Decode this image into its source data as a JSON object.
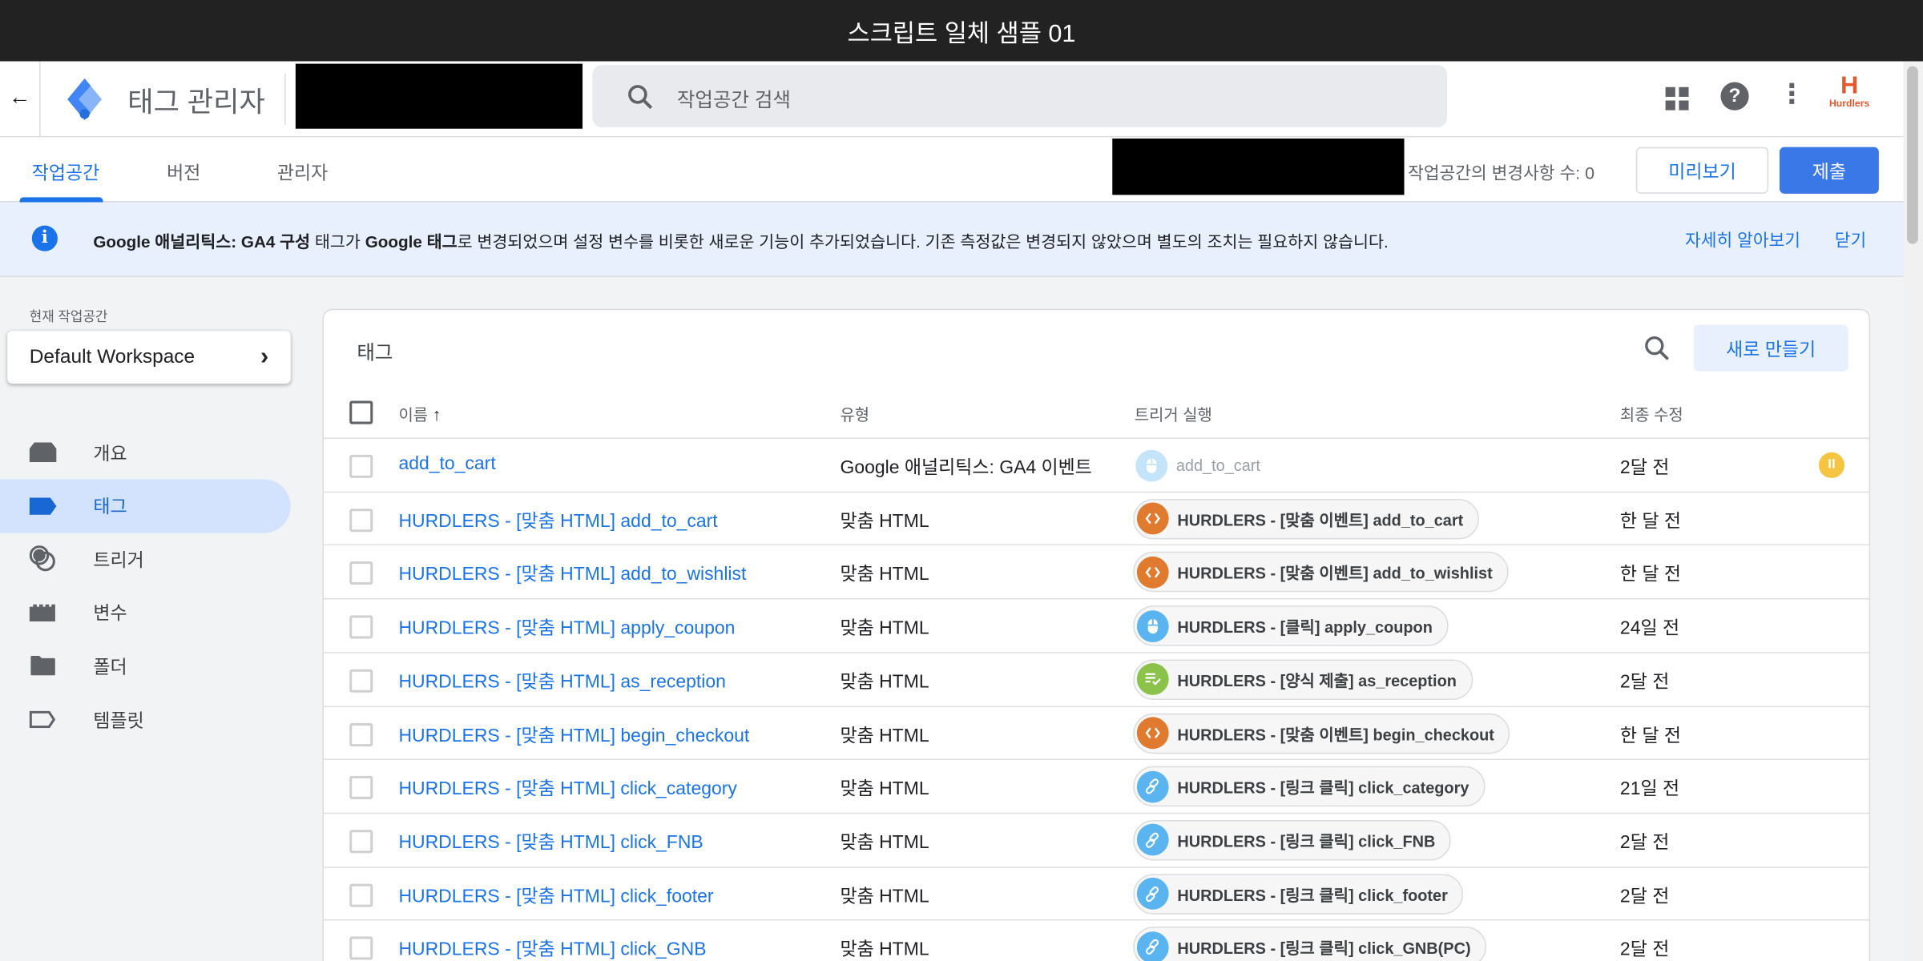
{
  "window_title": "스크립트 일체 샘플 01",
  "header": {
    "app_name": "태그 관리자",
    "search_placeholder": "작업공간 검색",
    "brand_logo_text": "Hurdlers"
  },
  "tabs": [
    {
      "label": "작업공간",
      "active": true
    },
    {
      "label": "버전",
      "active": false
    },
    {
      "label": "관리자",
      "active": false
    }
  ],
  "workspace_changes": "작업공간의 변경사항 수: 0",
  "preview_label": "미리보기",
  "submit_label": "제출",
  "banner": {
    "bold1": "Google 애널리틱스: GA4 구성",
    "text1": " 태그가 ",
    "bold2": "Google 태그",
    "text2": "로 변경되었으며 설정 변수를 비롯한 새로운 기능이 추가되었습니다. 기존 측정값은 변경되지 않았으며 별도의 조치는 필요하지 않습니다.",
    "learn_more": "자세히 알아보기",
    "close": "닫기"
  },
  "sidebar": {
    "workspace_label": "현재 작업공간",
    "workspace_name": "Default Workspace",
    "items": [
      {
        "label": "개요",
        "icon": "overview-icon"
      },
      {
        "label": "태그",
        "icon": "tag-icon",
        "active": true
      },
      {
        "label": "트리거",
        "icon": "trigger-icon"
      },
      {
        "label": "변수",
        "icon": "variable-icon"
      },
      {
        "label": "폴더",
        "icon": "folder-icon"
      },
      {
        "label": "템플릿",
        "icon": "template-icon"
      }
    ]
  },
  "tags_panel": {
    "title": "태그",
    "new_button": "새로 만들기",
    "columns": [
      "이름",
      "유형",
      "트리거 실행",
      "최종 수정"
    ],
    "rows": [
      {
        "name": "add_to_cart",
        "type": "Google 애널리틱스: GA4 이벤트",
        "trigger": "add_to_cart",
        "trigger_kind": "click",
        "paused": true,
        "modified": "2달 전"
      },
      {
        "name": "HURDLERS - [맞춤 HTML] add_to_cart",
        "type": "맞춤 HTML",
        "trigger": "HURDLERS - [맞춤 이벤트] add_to_cart",
        "trigger_kind": "custom",
        "modified": "한 달 전"
      },
      {
        "name": "HURDLERS - [맞춤 HTML] add_to_wishlist",
        "type": "맞춤 HTML",
        "trigger": "HURDLERS - [맞춤 이벤트] add_to_wishlist",
        "trigger_kind": "custom",
        "modified": "한 달 전"
      },
      {
        "name": "HURDLERS - [맞춤 HTML] apply_coupon",
        "type": "맞춤 HTML",
        "trigger": "HURDLERS - [클릭] apply_coupon",
        "trigger_kind": "click",
        "modified": "24일 전"
      },
      {
        "name": "HURDLERS - [맞춤 HTML] as_reception",
        "type": "맞춤 HTML",
        "trigger": "HURDLERS - [양식 제출] as_reception",
        "trigger_kind": "form",
        "modified": "2달 전"
      },
      {
        "name": "HURDLERS - [맞춤 HTML] begin_checkout",
        "type": "맞춤 HTML",
        "trigger": "HURDLERS - [맞춤 이벤트] begin_checkout",
        "trigger_kind": "custom",
        "modified": "한 달 전"
      },
      {
        "name": "HURDLERS - [맞춤 HTML] click_category",
        "type": "맞춤 HTML",
        "trigger": "HURDLERS - [링크 클릭] click_category",
        "trigger_kind": "link",
        "modified": "21일 전"
      },
      {
        "name": "HURDLERS - [맞춤 HTML] click_FNB",
        "type": "맞춤 HTML",
        "trigger": "HURDLERS - [링크 클릭] click_FNB",
        "trigger_kind": "link",
        "modified": "2달 전"
      },
      {
        "name": "HURDLERS - [맞춤 HTML] click_footer",
        "type": "맞춤 HTML",
        "trigger": "HURDLERS - [링크 클릭] click_footer",
        "trigger_kind": "link",
        "modified": "2달 전"
      },
      {
        "name": "HURDLERS - [맞춤 HTML] click_GNB",
        "type": "맞춤 HTML",
        "trigger": "HURDLERS - [링크 클릭] click_GNB(PC)",
        "trigger_kind": "link",
        "modified": "2달 전"
      }
    ]
  },
  "colors": {
    "accent": "#1a73e8",
    "submit": "#3b78e7",
    "custom": "#e07a2f",
    "click": "#5ab4f0",
    "form": "#8bc34a",
    "link": "#5ab4f0",
    "paused": "#f5c542"
  }
}
